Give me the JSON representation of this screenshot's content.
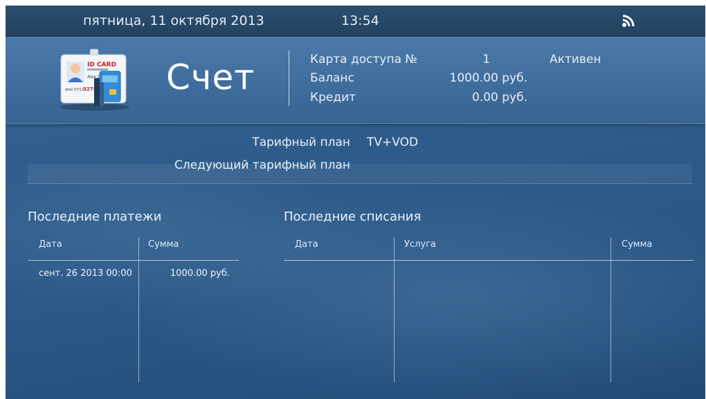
{
  "status_bar": {
    "date": "пятница, 11 октября 2013",
    "time": "13:54",
    "icon": "wifi-icon"
  },
  "header": {
    "card_icon": "id-card-icon",
    "card_text": {
      "title": "ID CARD",
      "name": "Alex Gr",
      "date": "date 07/13",
      "number": "3275"
    },
    "title": "Счет",
    "access_card_label": "Карта доступа №",
    "access_card_value": "1",
    "access_card_status": "Активен",
    "balance_label": "Баланс",
    "balance_value": "1000.00 руб.",
    "credit_label": "Кредит",
    "credit_value": "0.00 руб."
  },
  "tariff": {
    "plan_label": "Тарифный план",
    "plan_value": "TV+VOD",
    "next_plan_label": "Следующий тарифный план",
    "next_plan_value": ""
  },
  "payments": {
    "title": "Последние платежи",
    "columns": [
      "Дата",
      "Сумма"
    ],
    "rows": [
      {
        "date": "сент. 26 2013 00:00",
        "amount": "1000.00 руб."
      }
    ]
  },
  "charges": {
    "title": "Последние списания",
    "columns": [
      "Дата",
      "Услуга",
      "Сумма"
    ],
    "rows": []
  }
}
